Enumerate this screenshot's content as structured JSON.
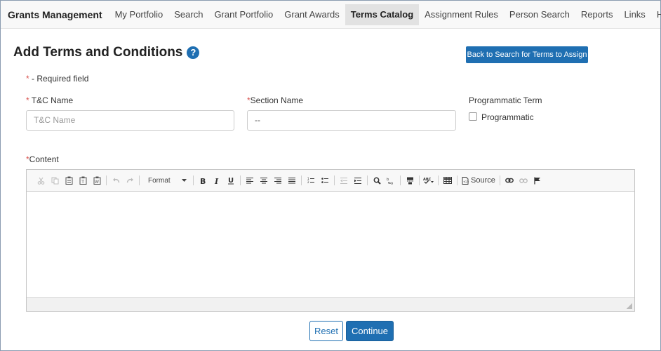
{
  "nav": {
    "brand": "Grants Management",
    "items": [
      {
        "label": "My Portfolio",
        "active": false
      },
      {
        "label": "Search",
        "active": false
      },
      {
        "label": "Grant Portfolio",
        "active": false
      },
      {
        "label": "Grant Awards",
        "active": false
      },
      {
        "label": "Terms Catalog",
        "active": true
      },
      {
        "label": "Assignment Rules",
        "active": false
      },
      {
        "label": "Person Search",
        "active": false
      },
      {
        "label": "Reports",
        "active": false
      },
      {
        "label": "Links",
        "active": false
      },
      {
        "label": "Help",
        "active": false
      }
    ]
  },
  "page": {
    "title": "Add Terms and Conditions",
    "help_icon_glyph": "?",
    "back_button": "Back to Search for Terms to Assign",
    "required_marker": "*",
    "required_note": " - Required field"
  },
  "form": {
    "tc_name": {
      "label": "T&C Name",
      "required": true,
      "placeholder": "T&C Name",
      "value": ""
    },
    "section_name": {
      "label": "Section Name",
      "required": true,
      "value": "--"
    },
    "programmatic": {
      "label": "Programmatic Term",
      "checkbox_label": "Programmatic",
      "checked": false
    },
    "content": {
      "label": "Content",
      "required": true
    }
  },
  "editor": {
    "format_label": "Format",
    "source_label": "Source",
    "icons": [
      "cut-icon",
      "copy-icon",
      "paste-icon",
      "paste-text-icon",
      "paste-word-icon",
      "undo-icon",
      "redo-icon",
      "bold-icon",
      "italic-icon",
      "underline-icon",
      "align-left-icon",
      "align-center-icon",
      "align-right-icon",
      "justify-icon",
      "numbered-list-icon",
      "bulleted-list-icon",
      "outdent-icon",
      "indent-icon",
      "find-icon",
      "replace-icon",
      "page-break-icon",
      "spellcheck-icon",
      "table-icon",
      "source-icon",
      "link-icon",
      "unlink-icon",
      "anchor-icon"
    ]
  },
  "actions": {
    "reset": "Reset",
    "continue": "Continue"
  },
  "colors": {
    "primary": "#1f6fb2",
    "required": "#d9534f"
  }
}
